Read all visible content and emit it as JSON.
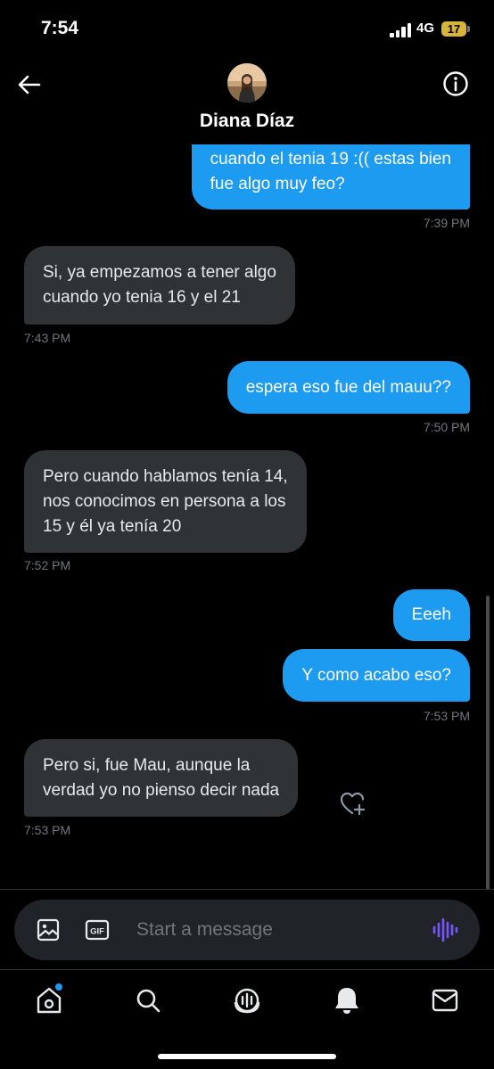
{
  "status_bar": {
    "time": "7:54",
    "network": "4G",
    "battery": "17"
  },
  "header": {
    "contact_name": "Diana Díaz"
  },
  "messages": [
    {
      "direction": "sent",
      "lines": [
        "cuando el tenia 19 :(( estas bien",
        "fue algo muy feo?"
      ],
      "time": "7:39 PM"
    },
    {
      "direction": "received",
      "lines": [
        "Si, ya empezamos a tener algo",
        "cuando yo tenia 16 y el 21"
      ],
      "time": "7:43 PM"
    },
    {
      "direction": "sent",
      "lines": [
        "espera eso fue del mauu??"
      ],
      "time": "7:50 PM"
    },
    {
      "direction": "received",
      "lines": [
        "Pero cuando hablamos tenía 14,",
        "nos conocimos en persona a los",
        "15 y él ya tenía 20"
      ],
      "time": "7:52 PM"
    },
    {
      "direction": "sent",
      "lines": [
        "Eeeh"
      ],
      "time": ""
    },
    {
      "direction": "sent",
      "lines": [
        "Y como acabo eso?"
      ],
      "time": "7:53 PM"
    },
    {
      "direction": "received",
      "lines": [
        "Pero si, fue Mau, aunque la",
        "verdad yo no pienso decir nada"
      ],
      "time": "7:53 PM"
    }
  ],
  "composer": {
    "placeholder": "Start a message",
    "value": ""
  },
  "icons": {
    "back": "arrow-left-icon",
    "info": "info-circle-icon",
    "image": "image-icon",
    "gif": "gif-icon",
    "voice": "voice-waveform-icon",
    "react": "heart-plus-icon",
    "tabs": [
      "home-icon",
      "search-icon",
      "spaces-icon",
      "notifications-icon",
      "messages-icon"
    ]
  },
  "colors": {
    "sent_bubble": "#1d9bf0",
    "received_bubble": "#2f3336",
    "timestamp": "#71767b",
    "voice_accent": "#7856ff",
    "battery": "#d7b43a"
  }
}
